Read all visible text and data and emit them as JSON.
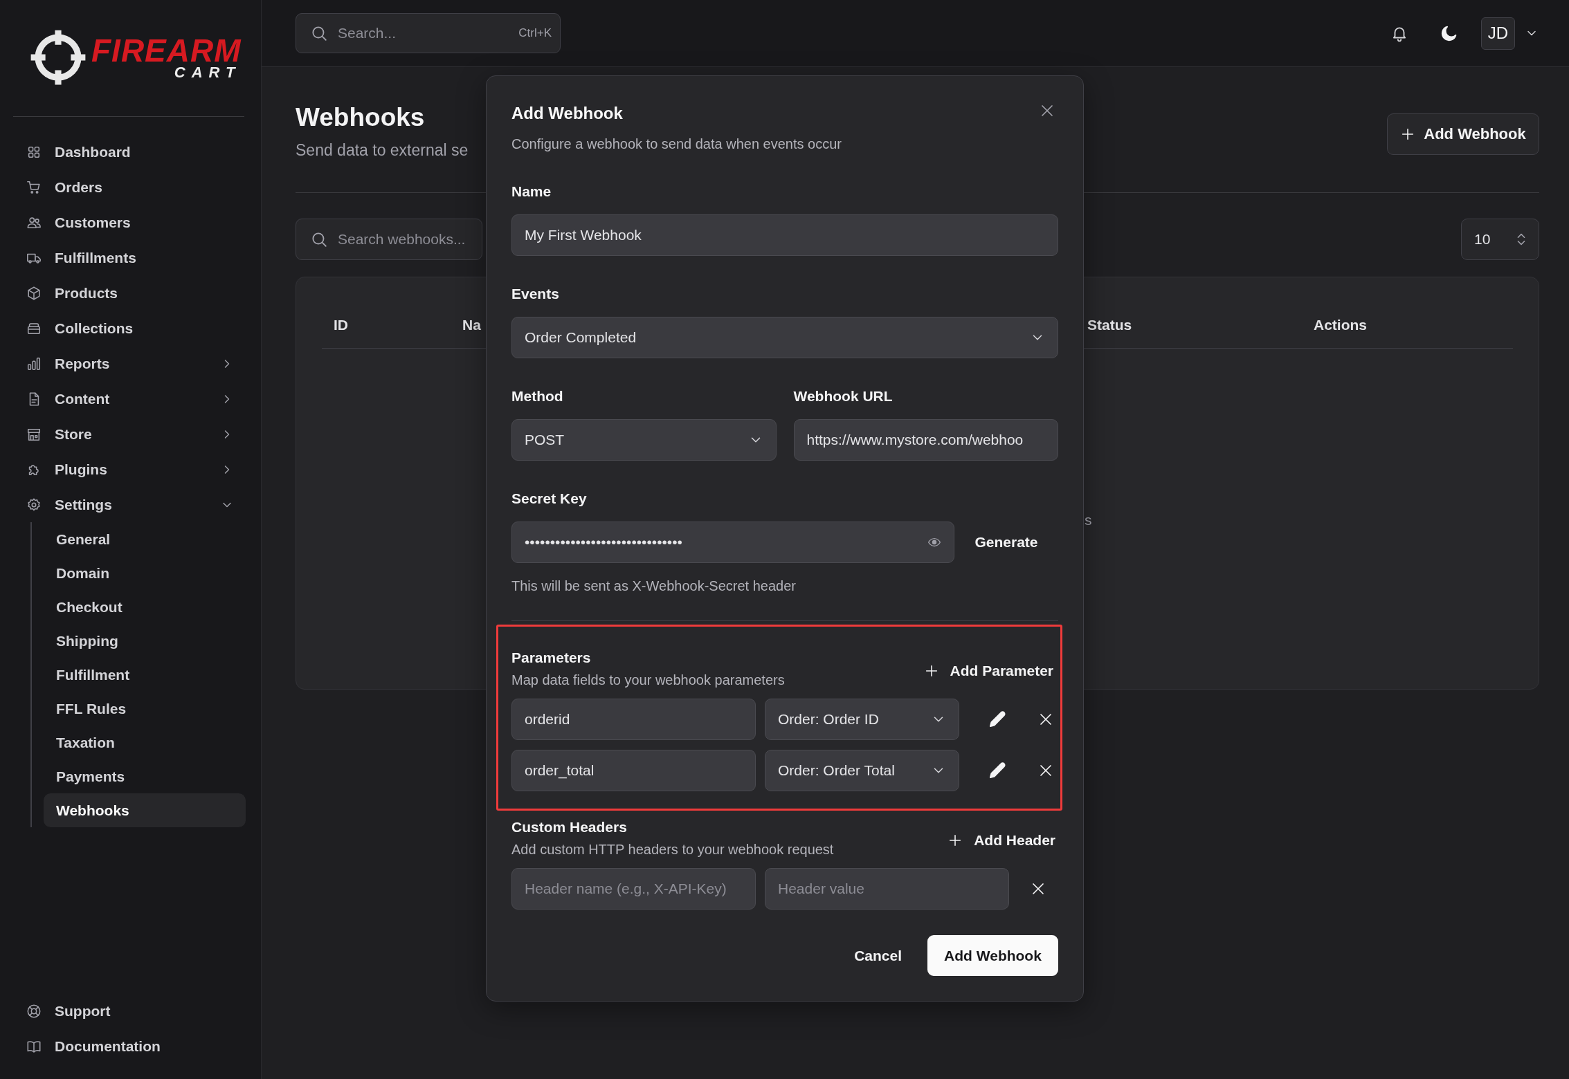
{
  "logo": {
    "wordmark": "FIREARM",
    "subtitle": "CART"
  },
  "sidebar": {
    "items": [
      {
        "label": "Dashboard"
      },
      {
        "label": "Orders"
      },
      {
        "label": "Customers"
      },
      {
        "label": "Fulfillments"
      },
      {
        "label": "Products"
      },
      {
        "label": "Collections"
      },
      {
        "label": "Reports",
        "expanded": false
      },
      {
        "label": "Content",
        "expanded": false
      },
      {
        "label": "Store",
        "expanded": false
      },
      {
        "label": "Plugins",
        "expanded": false
      },
      {
        "label": "Settings",
        "expanded": true,
        "children": [
          {
            "label": "General",
            "selected": false
          },
          {
            "label": "Domain",
            "selected": false
          },
          {
            "label": "Checkout",
            "selected": false
          },
          {
            "label": "Shipping",
            "selected": false
          },
          {
            "label": "Fulfillment",
            "selected": false
          },
          {
            "label": "FFL Rules",
            "selected": false
          },
          {
            "label": "Taxation",
            "selected": false
          },
          {
            "label": "Payments",
            "selected": false
          },
          {
            "label": "Webhooks",
            "selected": true
          }
        ]
      }
    ],
    "footer": [
      {
        "label": "Support"
      },
      {
        "label": "Documentation"
      }
    ]
  },
  "topbar": {
    "search": {
      "placeholder": "Search...",
      "shortcut": "Ctrl+K"
    },
    "avatar": "JD"
  },
  "page": {
    "title": "Webhooks",
    "subtitle": "Send data to external se",
    "add_button": "Add Webhook",
    "search": {
      "placeholder": "Search webhooks..."
    },
    "page_size": "10",
    "table": {
      "columns": [
        "ID",
        "Na",
        "Status",
        "Actions"
      ],
      "empty_text": "s"
    }
  },
  "modal": {
    "title": "Add Webhook",
    "description": "Configure a webhook to send data when events occur",
    "name": {
      "label": "Name",
      "value": "My First Webhook"
    },
    "events": {
      "label": "Events",
      "value": "Order Completed"
    },
    "method": {
      "label": "Method",
      "value": "POST"
    },
    "url": {
      "label": "Webhook URL",
      "value": "https://www.mystore.com/webhoo"
    },
    "secret": {
      "label": "Secret Key",
      "value": "•••••••••••••••••••••••••••••••",
      "generate": "Generate",
      "hint": "This will be sent as X-Webhook-Secret header"
    },
    "parameters": {
      "title": "Parameters",
      "description": "Map data fields to your webhook parameters",
      "add": "Add Parameter",
      "highlighted": true,
      "rows": [
        {
          "name": "orderid",
          "field": "Order: Order ID"
        },
        {
          "name": "order_total",
          "field": "Order: Order Total"
        }
      ]
    },
    "headers": {
      "title": "Custom Headers",
      "description": "Add custom HTTP headers to your webhook request",
      "add": "Add Header",
      "rows": [
        {
          "name_placeholder": "Header name (e.g., X-API-Key)",
          "value_placeholder": "Header value"
        }
      ]
    },
    "cancel": "Cancel",
    "submit": "Add Webhook"
  }
}
